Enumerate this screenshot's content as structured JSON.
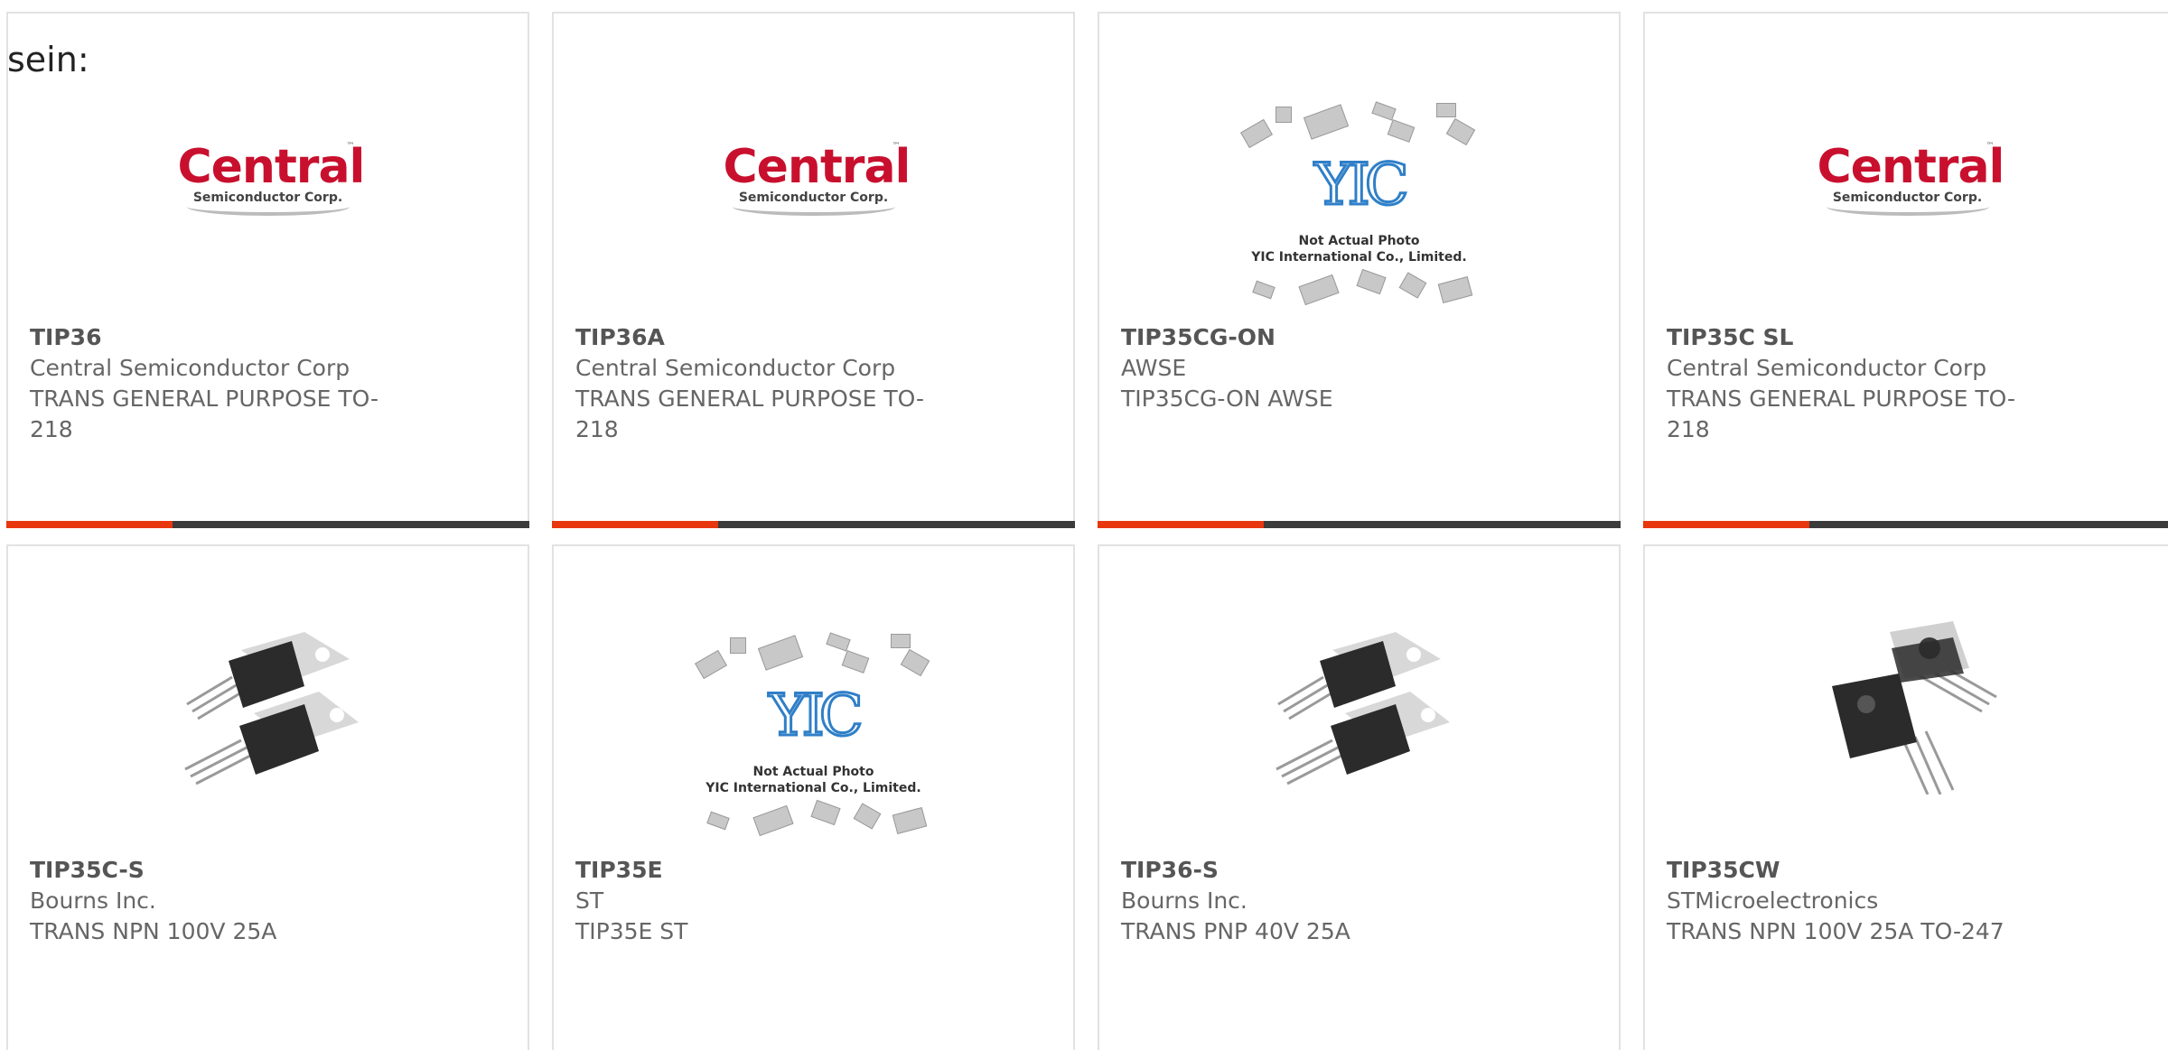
{
  "intro_text": "sein:",
  "cards": [
    {
      "part": "TIP36",
      "manufacturer": "Central Semiconductor Corp",
      "description": "TRANS GENERAL PURPOSE TO-218",
      "image": "central-logo"
    },
    {
      "part": "TIP36A",
      "manufacturer": "Central Semiconductor Corp",
      "description": "TRANS GENERAL PURPOSE TO-218",
      "image": "central-logo"
    },
    {
      "part": "TIP35CG-ON",
      "manufacturer": "AWSE",
      "description": "TIP35CG-ON AWSE",
      "image": "yic-placeholder"
    },
    {
      "part": "TIP35C SL",
      "manufacturer": "Central Semiconductor Corp",
      "description": "TRANS GENERAL PURPOSE TO-218",
      "image": "central-logo"
    },
    {
      "part": "TIP35C-S",
      "manufacturer": "Bourns Inc.",
      "description": "TRANS NPN 100V 25A",
      "image": "to220-pair"
    },
    {
      "part": "TIP35E",
      "manufacturer": "ST",
      "description": "TIP35E ST",
      "image": "yic-placeholder"
    },
    {
      "part": "TIP36-S",
      "manufacturer": "Bourns Inc.",
      "description": "TRANS PNP 40V 25A",
      "image": "to220-pair"
    },
    {
      "part": "TIP35CW",
      "manufacturer": "STMicroelectronics",
      "description": "TRANS NPN 100V 25A TO-247",
      "image": "to247-pair"
    }
  ],
  "central_logo": {
    "word": "Central",
    "sub": "Semiconductor Corp.",
    "tm": "™"
  },
  "yic_placeholder": {
    "logo": "YIC",
    "caption1": "Not Actual Photo",
    "caption2": "YIC International Co., Limited."
  },
  "colors": {
    "accent": "#e8360e",
    "bar": "#3b3b3b",
    "border": "#e2e2e2",
    "logo_red": "#c8102e",
    "yic_blue": "#2f7fc8"
  }
}
